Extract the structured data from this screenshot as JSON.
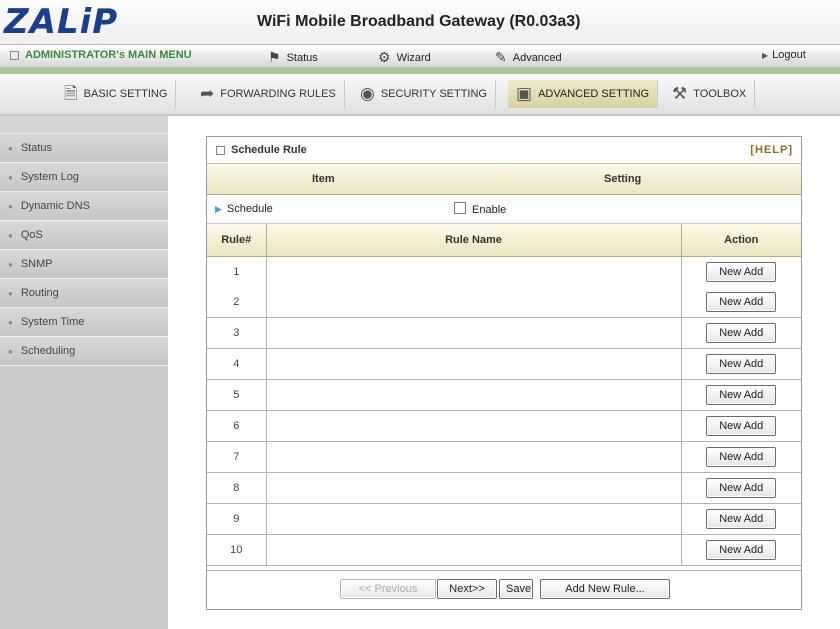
{
  "header": {
    "logo": "ZALiP",
    "title": "WiFi Mobile Broadband Gateway (R0.03a3)"
  },
  "menu": {
    "admin": "ADMINISTRATOR's MAIN MENU",
    "status": "Status",
    "wizard": "Wizard",
    "advanced": "Advanced",
    "logout": "Logout"
  },
  "tabs": [
    {
      "label": "BASIC SETTING",
      "icon": "document-icon"
    },
    {
      "label": "FORWARDING RULES",
      "icon": "forward-icon"
    },
    {
      "label": "SECURITY SETTING",
      "icon": "security-icon"
    },
    {
      "label": "ADVANCED SETTING",
      "icon": "advanced-icon"
    },
    {
      "label": "TOOLBOX",
      "icon": "toolbox-icon"
    }
  ],
  "sidebar": {
    "items": [
      "Status",
      "System Log",
      "Dynamic DNS",
      "QoS",
      "SNMP",
      "Routing",
      "System Time",
      "Scheduling"
    ]
  },
  "panel": {
    "title": "Schedule Rule",
    "help": "[HELP]",
    "col_item": "Item",
    "col_setting": "Setting",
    "schedule_label": "Schedule",
    "enable_label": "Enable",
    "enable_checked": false
  },
  "table": {
    "headers": [
      "Rule#",
      "Rule Name",
      "Action"
    ],
    "rows": [
      {
        "num": "1",
        "name": "",
        "action": "New Add"
      },
      {
        "num": "2",
        "name": "",
        "action": "New Add"
      },
      {
        "num": "3",
        "name": "",
        "action": "New Add"
      },
      {
        "num": "4",
        "name": "",
        "action": "New Add"
      },
      {
        "num": "5",
        "name": "",
        "action": "New Add"
      },
      {
        "num": "6",
        "name": "",
        "action": "New Add"
      },
      {
        "num": "7",
        "name": "",
        "action": "New Add"
      },
      {
        "num": "8",
        "name": "",
        "action": "New Add"
      },
      {
        "num": "9",
        "name": "",
        "action": "New Add"
      },
      {
        "num": "10",
        "name": "",
        "action": "New Add"
      }
    ]
  },
  "footer": {
    "previous": "<< Previous",
    "next": "Next>>",
    "save": "Save",
    "add_new": "Add New Rule..."
  },
  "colors": {
    "logo": "#1a3f8f",
    "admin_text": "#3a8a3a",
    "green_bar": "#a9c79a",
    "active_tab": "#e6dfb6",
    "help": "#8a6d1e"
  }
}
